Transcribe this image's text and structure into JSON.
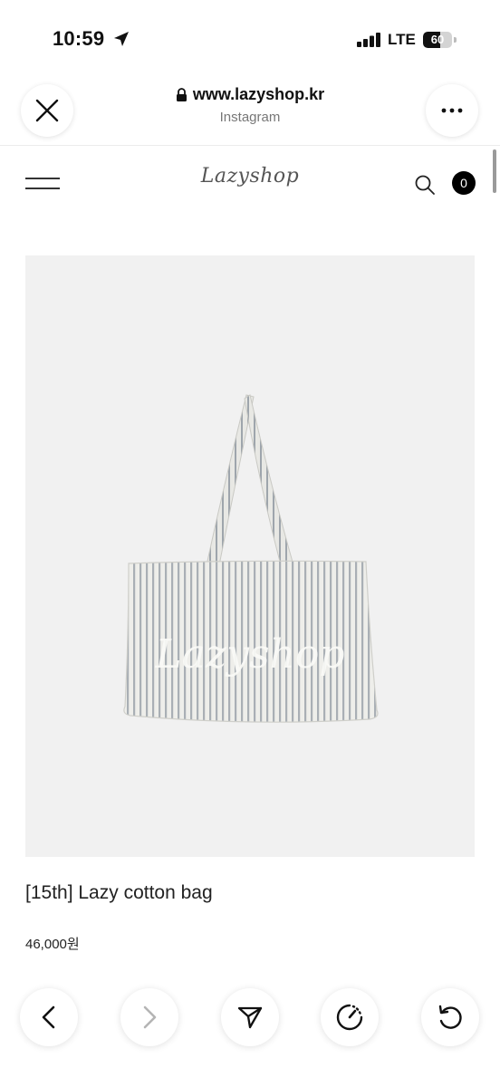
{
  "status_bar": {
    "time": "10:59",
    "network": "LTE",
    "battery": "60",
    "battery_level": 0.6
  },
  "browser": {
    "url": "www.lazyshop.kr",
    "source": "Instagram"
  },
  "site": {
    "logo": "Lazyshop",
    "cart_count": "0"
  },
  "product": {
    "image_text": "Lazyshop",
    "name": "[15th] Lazy cotton bag",
    "price": "46,000원"
  },
  "icons": {
    "close": "close-icon",
    "more": "more-icon",
    "lock": "lock-icon",
    "menu": "hamburger-icon",
    "search": "search-icon",
    "back": "chevron-left-icon",
    "forward": "chevron-right-icon",
    "share": "send-icon",
    "speed": "speed-icon",
    "reload": "reload-icon"
  },
  "colors": {
    "accent": "#000000",
    "image_bg": "#f1f1f1"
  }
}
